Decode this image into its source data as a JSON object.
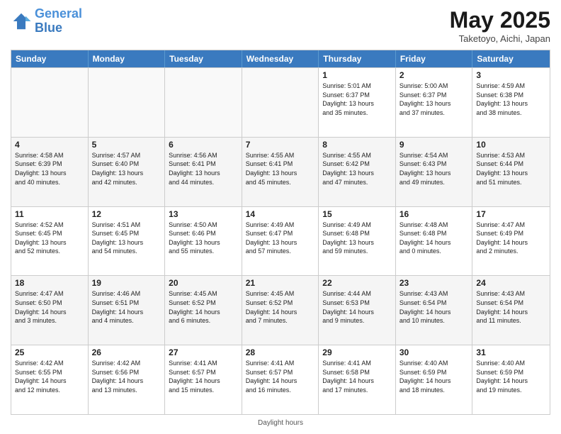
{
  "header": {
    "logo_line1": "General",
    "logo_line2": "Blue",
    "month": "May 2025",
    "location": "Taketoyo, Aichi, Japan"
  },
  "days_of_week": [
    "Sunday",
    "Monday",
    "Tuesday",
    "Wednesday",
    "Thursday",
    "Friday",
    "Saturday"
  ],
  "footer": "Daylight hours",
  "weeks": [
    [
      {
        "num": "",
        "info": "",
        "empty": true
      },
      {
        "num": "",
        "info": "",
        "empty": true
      },
      {
        "num": "",
        "info": "",
        "empty": true
      },
      {
        "num": "",
        "info": "",
        "empty": true
      },
      {
        "num": "1",
        "info": "Sunrise: 5:01 AM\nSunset: 6:37 PM\nDaylight: 13 hours\nand 35 minutes.",
        "empty": false
      },
      {
        "num": "2",
        "info": "Sunrise: 5:00 AM\nSunset: 6:37 PM\nDaylight: 13 hours\nand 37 minutes.",
        "empty": false
      },
      {
        "num": "3",
        "info": "Sunrise: 4:59 AM\nSunset: 6:38 PM\nDaylight: 13 hours\nand 38 minutes.",
        "empty": false
      }
    ],
    [
      {
        "num": "4",
        "info": "Sunrise: 4:58 AM\nSunset: 6:39 PM\nDaylight: 13 hours\nand 40 minutes.",
        "empty": false
      },
      {
        "num": "5",
        "info": "Sunrise: 4:57 AM\nSunset: 6:40 PM\nDaylight: 13 hours\nand 42 minutes.",
        "empty": false
      },
      {
        "num": "6",
        "info": "Sunrise: 4:56 AM\nSunset: 6:41 PM\nDaylight: 13 hours\nand 44 minutes.",
        "empty": false
      },
      {
        "num": "7",
        "info": "Sunrise: 4:55 AM\nSunset: 6:41 PM\nDaylight: 13 hours\nand 45 minutes.",
        "empty": false
      },
      {
        "num": "8",
        "info": "Sunrise: 4:55 AM\nSunset: 6:42 PM\nDaylight: 13 hours\nand 47 minutes.",
        "empty": false
      },
      {
        "num": "9",
        "info": "Sunrise: 4:54 AM\nSunset: 6:43 PM\nDaylight: 13 hours\nand 49 minutes.",
        "empty": false
      },
      {
        "num": "10",
        "info": "Sunrise: 4:53 AM\nSunset: 6:44 PM\nDaylight: 13 hours\nand 51 minutes.",
        "empty": false
      }
    ],
    [
      {
        "num": "11",
        "info": "Sunrise: 4:52 AM\nSunset: 6:45 PM\nDaylight: 13 hours\nand 52 minutes.",
        "empty": false
      },
      {
        "num": "12",
        "info": "Sunrise: 4:51 AM\nSunset: 6:45 PM\nDaylight: 13 hours\nand 54 minutes.",
        "empty": false
      },
      {
        "num": "13",
        "info": "Sunrise: 4:50 AM\nSunset: 6:46 PM\nDaylight: 13 hours\nand 55 minutes.",
        "empty": false
      },
      {
        "num": "14",
        "info": "Sunrise: 4:49 AM\nSunset: 6:47 PM\nDaylight: 13 hours\nand 57 minutes.",
        "empty": false
      },
      {
        "num": "15",
        "info": "Sunrise: 4:49 AM\nSunset: 6:48 PM\nDaylight: 13 hours\nand 59 minutes.",
        "empty": false
      },
      {
        "num": "16",
        "info": "Sunrise: 4:48 AM\nSunset: 6:48 PM\nDaylight: 14 hours\nand 0 minutes.",
        "empty": false
      },
      {
        "num": "17",
        "info": "Sunrise: 4:47 AM\nSunset: 6:49 PM\nDaylight: 14 hours\nand 2 minutes.",
        "empty": false
      }
    ],
    [
      {
        "num": "18",
        "info": "Sunrise: 4:47 AM\nSunset: 6:50 PM\nDaylight: 14 hours\nand 3 minutes.",
        "empty": false
      },
      {
        "num": "19",
        "info": "Sunrise: 4:46 AM\nSunset: 6:51 PM\nDaylight: 14 hours\nand 4 minutes.",
        "empty": false
      },
      {
        "num": "20",
        "info": "Sunrise: 4:45 AM\nSunset: 6:52 PM\nDaylight: 14 hours\nand 6 minutes.",
        "empty": false
      },
      {
        "num": "21",
        "info": "Sunrise: 4:45 AM\nSunset: 6:52 PM\nDaylight: 14 hours\nand 7 minutes.",
        "empty": false
      },
      {
        "num": "22",
        "info": "Sunrise: 4:44 AM\nSunset: 6:53 PM\nDaylight: 14 hours\nand 9 minutes.",
        "empty": false
      },
      {
        "num": "23",
        "info": "Sunrise: 4:43 AM\nSunset: 6:54 PM\nDaylight: 14 hours\nand 10 minutes.",
        "empty": false
      },
      {
        "num": "24",
        "info": "Sunrise: 4:43 AM\nSunset: 6:54 PM\nDaylight: 14 hours\nand 11 minutes.",
        "empty": false
      }
    ],
    [
      {
        "num": "25",
        "info": "Sunrise: 4:42 AM\nSunset: 6:55 PM\nDaylight: 14 hours\nand 12 minutes.",
        "empty": false
      },
      {
        "num": "26",
        "info": "Sunrise: 4:42 AM\nSunset: 6:56 PM\nDaylight: 14 hours\nand 13 minutes.",
        "empty": false
      },
      {
        "num": "27",
        "info": "Sunrise: 4:41 AM\nSunset: 6:57 PM\nDaylight: 14 hours\nand 15 minutes.",
        "empty": false
      },
      {
        "num": "28",
        "info": "Sunrise: 4:41 AM\nSunset: 6:57 PM\nDaylight: 14 hours\nand 16 minutes.",
        "empty": false
      },
      {
        "num": "29",
        "info": "Sunrise: 4:41 AM\nSunset: 6:58 PM\nDaylight: 14 hours\nand 17 minutes.",
        "empty": false
      },
      {
        "num": "30",
        "info": "Sunrise: 4:40 AM\nSunset: 6:59 PM\nDaylight: 14 hours\nand 18 minutes.",
        "empty": false
      },
      {
        "num": "31",
        "info": "Sunrise: 4:40 AM\nSunset: 6:59 PM\nDaylight: 14 hours\nand 19 minutes.",
        "empty": false
      }
    ]
  ]
}
